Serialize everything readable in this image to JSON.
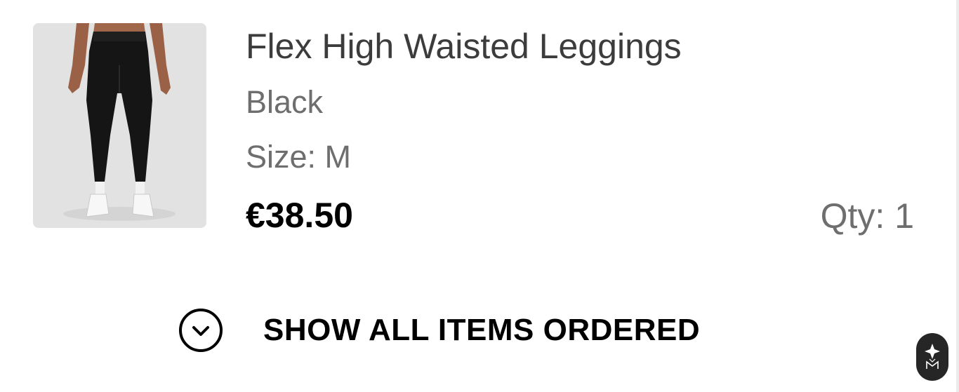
{
  "order_item": {
    "image_alt": "Flex High Waisted Leggings - Black",
    "name": "Flex High Waisted Leggings",
    "color": "Black",
    "size": "Size: M",
    "price": "€38.50",
    "quantity": "Qty: 1"
  },
  "show_all": {
    "label": "SHOW ALL ITEMS ORDERED",
    "icon": "chevron-down-circle-icon"
  },
  "badge": {
    "icon": "brand-logo-icon"
  },
  "colors": {
    "background": "#ffffff",
    "thumbnail_bg": "#e3e3e3",
    "primary_text": "#3c3c3c",
    "secondary_text": "#6e6e6e",
    "price_text": "#000000",
    "badge_bg": "#262626"
  }
}
